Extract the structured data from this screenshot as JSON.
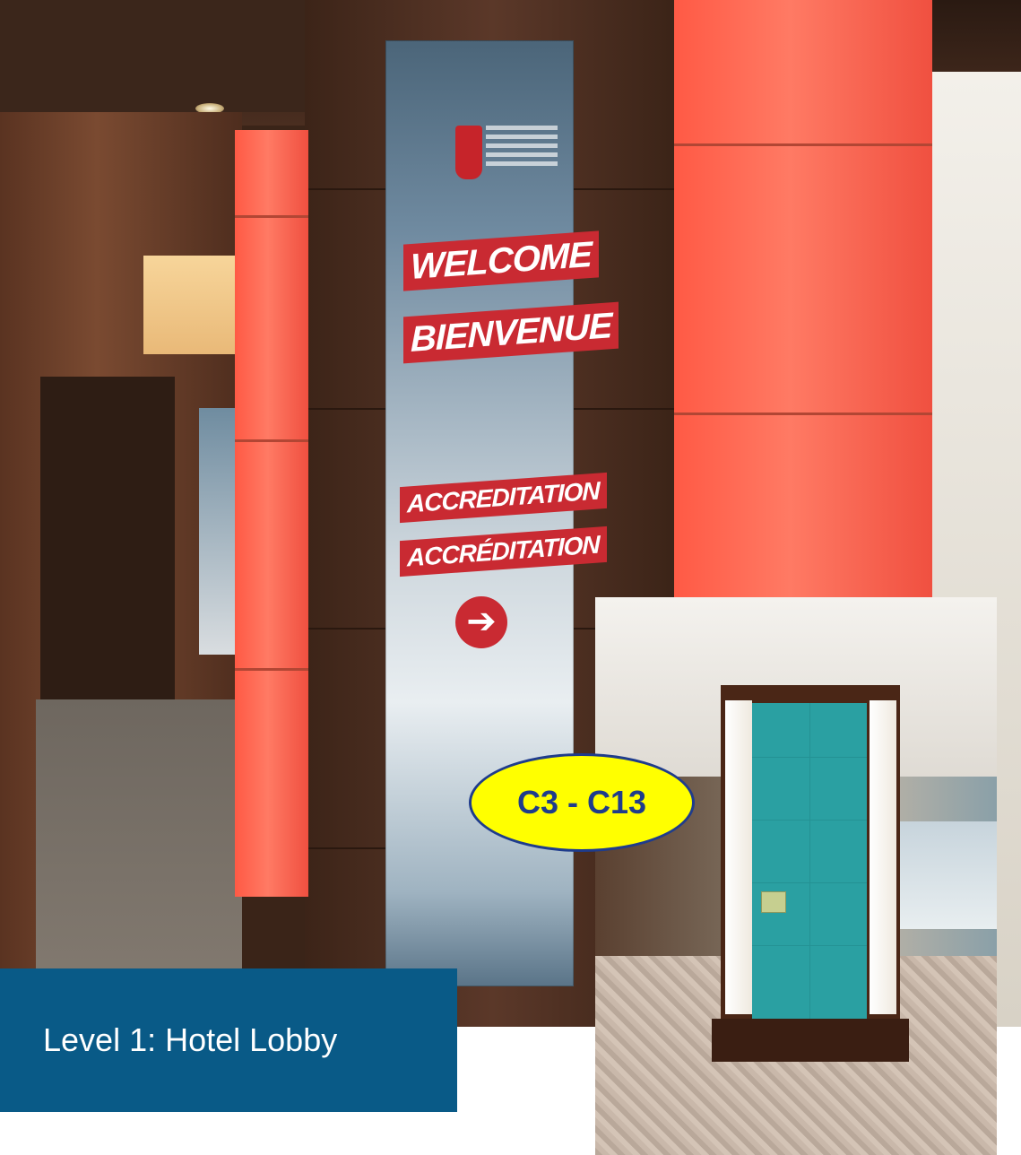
{
  "banner": {
    "line1": "WELCOME",
    "line2": "BIENVENUE",
    "line3": "ACCREDITATION",
    "line4": "ACCRÉDITATION",
    "arrow": "➔"
  },
  "label_bubble": {
    "text": "C3 - C13",
    "fill": "#ffff00",
    "text_color": "#1f3c8c"
  },
  "caption": {
    "text": "Level 1: Hotel Lobby",
    "background": "#095a87"
  },
  "icons": {
    "banner_arrow": "right-arrow-icon"
  }
}
